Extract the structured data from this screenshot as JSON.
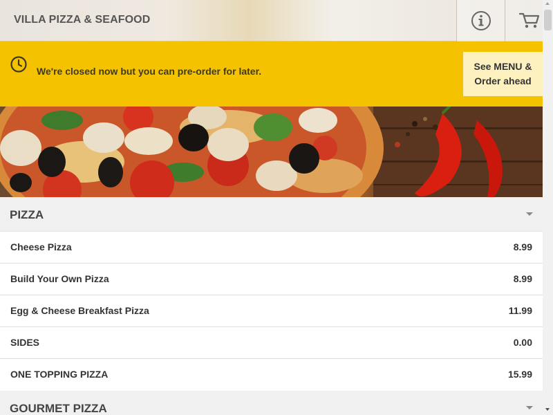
{
  "header": {
    "brand": "VILLA PIZZA & SEAFOOD",
    "info_icon": "info-icon",
    "cart_icon": "cart-icon"
  },
  "notice": {
    "icon": "clock-icon",
    "text": "We're closed now but you can pre-order for later.",
    "button_label": "See MENU &\nOrder ahead"
  },
  "hero": {
    "image": "pizza-banner"
  },
  "menu": {
    "sections": [
      {
        "title": "PIZZA",
        "items": [
          {
            "name": "Cheese Pizza",
            "price": "8.99"
          },
          {
            "name": "Build Your Own Pizza",
            "price": "8.99"
          },
          {
            "name": "Egg & Cheese Breakfast Pizza",
            "price": "11.99"
          },
          {
            "name": "SIDES",
            "price": "0.00"
          },
          {
            "name": "ONE TOPPING PIZZA",
            "price": "15.99"
          }
        ]
      },
      {
        "title": "GOURMET PIZZA",
        "items": []
      }
    ]
  },
  "colors": {
    "notice_bg": "#f5c200",
    "button_bg": "#fdf2bf",
    "section_bg": "#f0f0f0"
  }
}
